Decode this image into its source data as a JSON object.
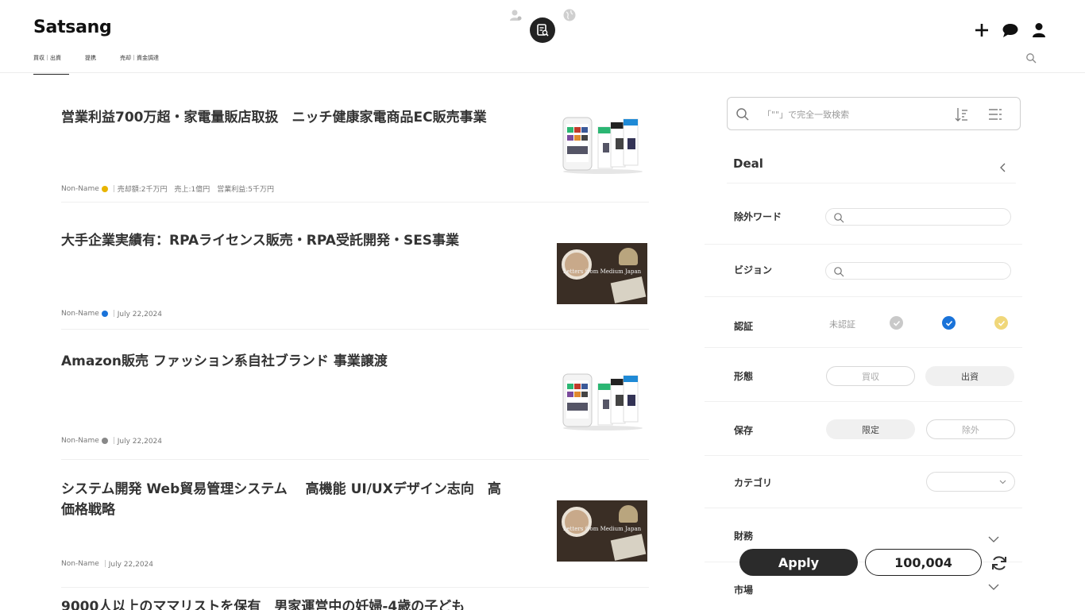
{
  "header": {
    "brand": "Satsang",
    "nav": [
      "買収｜出資",
      "提携",
      "売却｜資金調達"
    ]
  },
  "listings": [
    {
      "title": "営業利益700万超・家電量販店取扱　ニッチ健康家電商品EC販売事業",
      "author": "Non-Name",
      "badge_color": "#e8b400",
      "meta": "｜売却額:2千万円　売上:1億円　営業利益:5千万円",
      "thumb": "phones"
    },
    {
      "title": "大手企業実績有：RPAライセンス販売・RPA受託開発・SES事業",
      "author": "Non-Name",
      "badge_color": "#1a73d9",
      "meta": "｜July 22,2024",
      "thumb": "coffee"
    },
    {
      "title": "Amazon販売 ファッション系自社ブランド 事業譲渡",
      "author": "Non-Name",
      "badge_color": "#888888",
      "meta": "｜July 22,2024",
      "thumb": "phones"
    },
    {
      "title": "システム開発 Web貿易管理システム　 高機能 UI/UXデザイン志向　高価格戦略",
      "author": "Non-Name",
      "badge_color": "",
      "meta": "｜July 22,2024",
      "thumb": "coffee"
    },
    {
      "title": "9000人以上のママリストを保有　男家運営中の妊婦-4歳の子ども",
      "author": "",
      "badge_color": "",
      "meta": "",
      "thumb": ""
    }
  ],
  "thumb_caption": "Letters from Medium Japan",
  "panel": {
    "search_placeholder": "「\"\"」で完全一致検索",
    "section_title": "Deal",
    "exclude_label": "除外ワード",
    "vision_label": "ビジョン",
    "cert_label": "認証",
    "cert_unverified": "未認証",
    "form_label": "形態",
    "form_options": [
      "買収",
      "出資"
    ],
    "save_label": "保存",
    "save_options": [
      "限定",
      "除外"
    ],
    "category_label": "カテゴリ",
    "finance_label": "財務",
    "market_label": "市場",
    "apply_label": "Apply",
    "count": "100,004"
  },
  "colors": {
    "accent": "#222222",
    "verified_blue": "#1a73d9",
    "gold": "#f0c94a"
  }
}
